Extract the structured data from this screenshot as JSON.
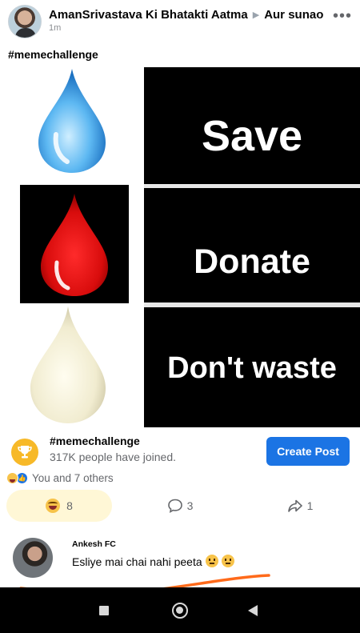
{
  "post": {
    "author": "AmanSrivastava Ki Bhatakti Aatma",
    "group": "Aur sunao",
    "timestamp": "1m",
    "caption": "#memechallenge",
    "more_icon": "more-horizontal-icon"
  },
  "meme": {
    "panel_words": [
      "Save",
      "Donate",
      "Don't waste"
    ],
    "drop_colors": [
      "#4aa8ee",
      "#e01414",
      "#f3f0d8"
    ]
  },
  "challenge": {
    "title": "#memechallenge",
    "subtitle": "317K people have joined.",
    "button": "Create Post",
    "icon": "trophy-icon"
  },
  "reactions": {
    "summary": "You and 7 others"
  },
  "actions": {
    "haha_count": "8",
    "comment_count": "3",
    "share_count": "1"
  },
  "comment": {
    "name": "Ankesh FC",
    "text": "Esliye mai chai nahi peeta"
  },
  "colors": {
    "accent": "#1b74e4",
    "highlight": "#fff7d6",
    "marker": "#ff6a1a"
  }
}
